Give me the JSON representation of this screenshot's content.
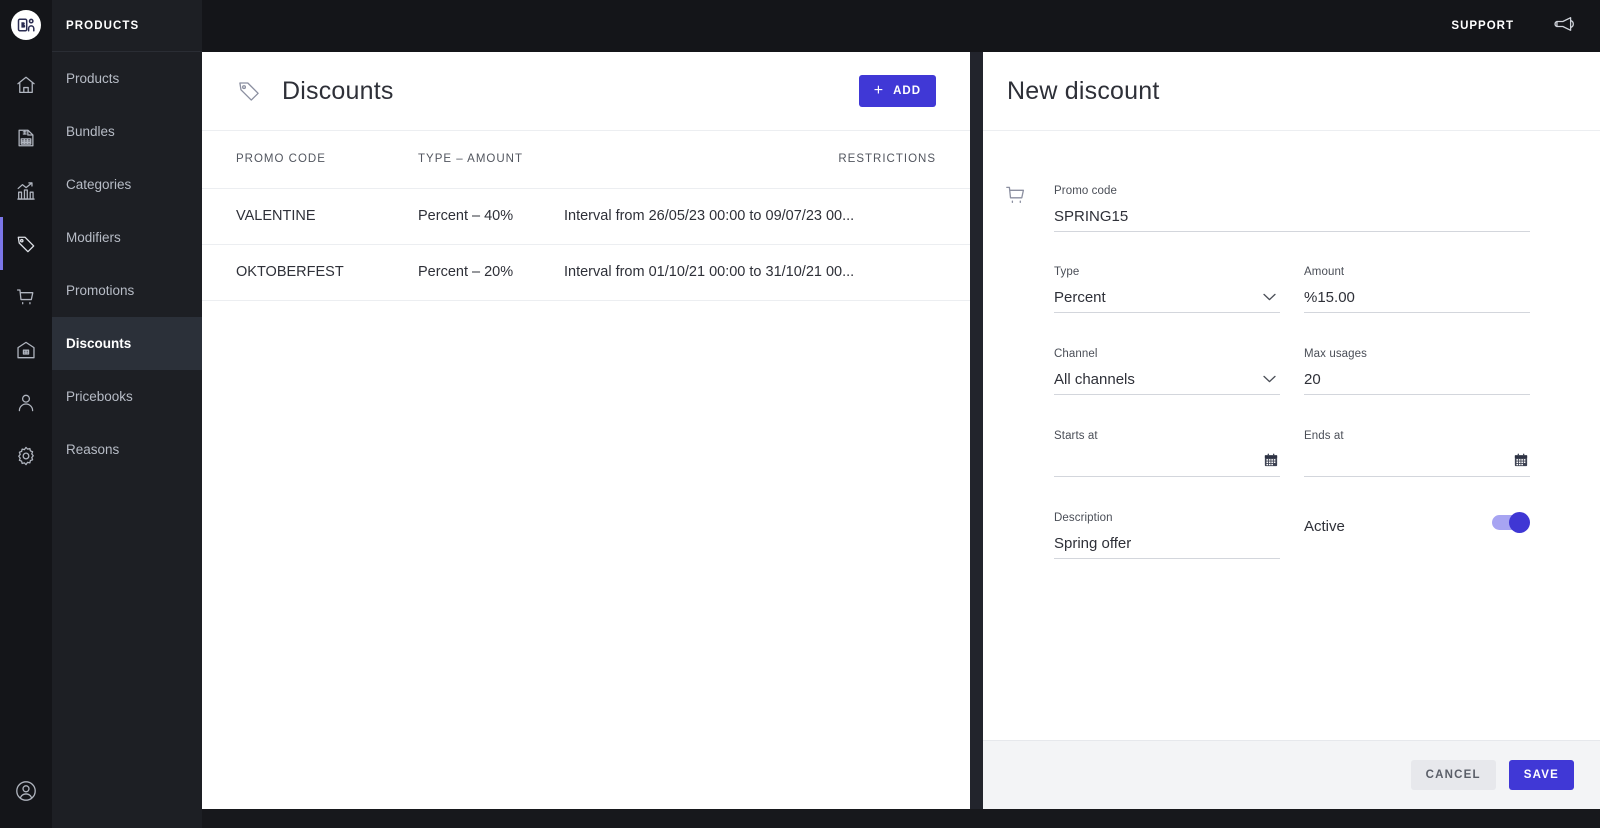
{
  "brand": {
    "logo_icon": "brand-logo-icon",
    "accent_color": "#4038d6",
    "dark_color": "#141519"
  },
  "topbar": {
    "support_label": "SUPPORT",
    "megaphone_icon": "megaphone-icon"
  },
  "rail": {
    "items": [
      {
        "icon": "home-icon",
        "name": "home",
        "active": false
      },
      {
        "icon": "invoice-icon",
        "name": "billing",
        "active": false
      },
      {
        "icon": "analytics-icon",
        "name": "analytics",
        "active": false
      },
      {
        "icon": "tag-icon",
        "name": "products",
        "active": true
      },
      {
        "icon": "cart-icon",
        "name": "orders",
        "active": false
      },
      {
        "icon": "warehouse-icon",
        "name": "inventory",
        "active": false
      },
      {
        "icon": "person-icon",
        "name": "customers",
        "active": false
      },
      {
        "icon": "gear-icon",
        "name": "settings",
        "active": false
      }
    ],
    "account_icon": "account-avatar-icon"
  },
  "sidebar": {
    "title": "PRODUCTS",
    "items": [
      {
        "label": "Products",
        "active": false
      },
      {
        "label": "Bundles",
        "active": false
      },
      {
        "label": "Categories",
        "active": false
      },
      {
        "label": "Modifiers",
        "active": false
      },
      {
        "label": "Promotions",
        "active": false
      },
      {
        "label": "Discounts",
        "active": true
      },
      {
        "label": "Pricebooks",
        "active": false
      },
      {
        "label": "Reasons",
        "active": false
      }
    ]
  },
  "list": {
    "title": "Discounts",
    "title_icon": "tag-icon",
    "add_label": "ADD",
    "add_icon": "plus-icon",
    "columns": [
      "PROMO CODE",
      "TYPE – AMOUNT",
      "RESTRICTIONS"
    ],
    "rows": [
      {
        "promo_code": "VALENTINE",
        "type_amount": "Percent – 40%",
        "restrictions": "Interval from 26/05/23 00:00 to 09/07/23 00..."
      },
      {
        "promo_code": "OKTOBERFEST",
        "type_amount": "Percent – 20%",
        "restrictions": "Interval from 01/10/21 00:00 to 31/10/21 00..."
      }
    ]
  },
  "detail": {
    "title": "New discount",
    "section_icon": "cart-icon",
    "fields": {
      "promo_code": {
        "label": "Promo code",
        "value": "SPRING15",
        "placeholder": ""
      },
      "type": {
        "label": "Type",
        "value": "Percent",
        "chevron_icon": "chevron-down-icon"
      },
      "amount": {
        "label": "Amount",
        "value": "%15.00",
        "placeholder": ""
      },
      "channel": {
        "label": "Channel",
        "value": "All channels",
        "chevron_icon": "chevron-down-icon"
      },
      "max_usages": {
        "label": "Max usages",
        "value": "20",
        "placeholder": ""
      },
      "starts_at": {
        "label": "Starts at",
        "value": "",
        "placeholder": "",
        "calendar_icon": "calendar-icon"
      },
      "ends_at": {
        "label": "Ends at",
        "value": "",
        "placeholder": "",
        "calendar_icon": "calendar-icon"
      },
      "description": {
        "label": "Description",
        "value": "Spring offer",
        "placeholder": ""
      },
      "active": {
        "label": "Active",
        "value": "on"
      }
    },
    "footer": {
      "cancel_label": "CANCEL",
      "save_label": "SAVE"
    }
  }
}
